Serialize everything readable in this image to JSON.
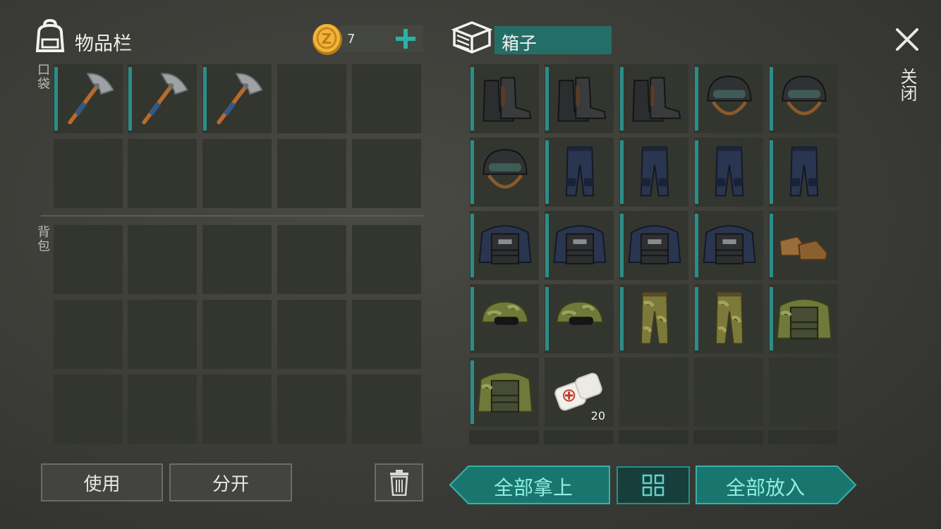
{
  "inventory": {
    "title": "物品栏",
    "pocket_label": "口袋",
    "backpack_label": "背包",
    "coin_count": "7",
    "pocket_slots": [
      {
        "item": "pickaxe-icon",
        "filled": true
      },
      {
        "item": "pickaxe-icon",
        "filled": true
      },
      {
        "item": "pickaxe-icon",
        "filled": true
      },
      {
        "item": "",
        "filled": false
      },
      {
        "item": "",
        "filled": false
      },
      {
        "item": "",
        "filled": false
      },
      {
        "item": "",
        "filled": false
      },
      {
        "item": "",
        "filled": false
      },
      {
        "item": "",
        "filled": false
      },
      {
        "item": "",
        "filled": false
      }
    ],
    "backpack_slot_count": 15
  },
  "box": {
    "title": "箱子",
    "slots": [
      {
        "item": "boots-icon",
        "filled": true,
        "count": ""
      },
      {
        "item": "boots-icon",
        "filled": true,
        "count": ""
      },
      {
        "item": "boots-icon",
        "filled": true,
        "count": ""
      },
      {
        "item": "helmet-icon",
        "filled": true,
        "count": ""
      },
      {
        "item": "helmet-icon",
        "filled": true,
        "count": ""
      },
      {
        "item": "helmet-icon",
        "filled": true,
        "count": ""
      },
      {
        "item": "police-pants-icon",
        "filled": true,
        "count": ""
      },
      {
        "item": "police-pants-icon",
        "filled": true,
        "count": ""
      },
      {
        "item": "police-pants-icon",
        "filled": true,
        "count": ""
      },
      {
        "item": "police-pants-icon",
        "filled": true,
        "count": ""
      },
      {
        "item": "police-vest-icon",
        "filled": true,
        "count": ""
      },
      {
        "item": "police-vest-icon",
        "filled": true,
        "count": ""
      },
      {
        "item": "police-vest-icon",
        "filled": true,
        "count": ""
      },
      {
        "item": "police-vest-icon",
        "filled": true,
        "count": ""
      },
      {
        "item": "brown-shoes-icon",
        "filled": true,
        "count": ""
      },
      {
        "item": "camo-cap-icon",
        "filled": true,
        "count": ""
      },
      {
        "item": "camo-cap-icon",
        "filled": true,
        "count": ""
      },
      {
        "item": "camo-pants-icon",
        "filled": true,
        "count": ""
      },
      {
        "item": "camo-pants-icon",
        "filled": true,
        "count": ""
      },
      {
        "item": "camo-vest-icon",
        "filled": true,
        "count": ""
      },
      {
        "item": "camo-vest-icon",
        "filled": true,
        "count": ""
      },
      {
        "item": "bandage-icon",
        "filled": false,
        "count": "20"
      },
      {
        "item": "",
        "filled": false,
        "count": ""
      },
      {
        "item": "",
        "filled": false,
        "count": ""
      },
      {
        "item": "",
        "filled": false,
        "count": ""
      }
    ]
  },
  "buttons": {
    "use": "使用",
    "split": "分开",
    "take_all": "全部拿上",
    "put_all": "全部放入"
  },
  "close_label": "关闭",
  "colors": {
    "accent": "#2a8e88",
    "teal_button": "#19766f",
    "teal_text": "#8feee4",
    "slot_bg": "#33352f"
  }
}
